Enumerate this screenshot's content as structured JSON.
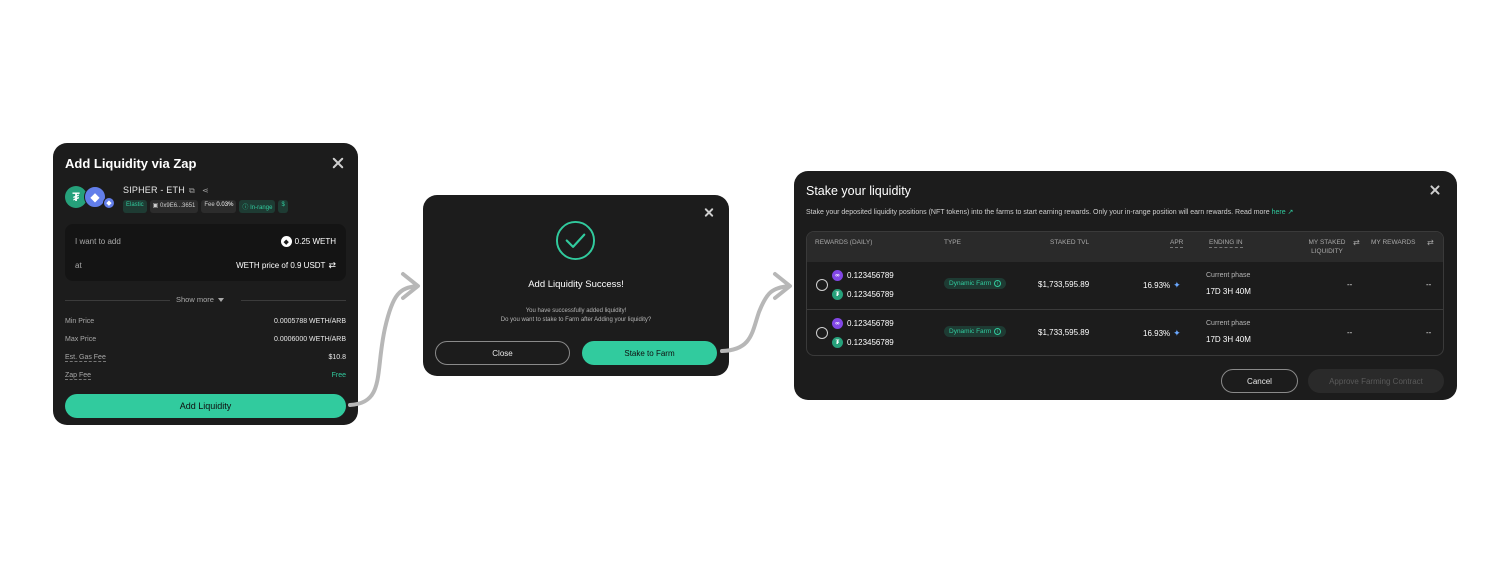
{
  "zap": {
    "title": "Add Liquidity via Zap",
    "pair": "SIPHER - ETH",
    "token_a_icon": "usdt-token-icon",
    "token_b_icon": "eth-token-icon",
    "badges": {
      "elastic": "Elastic",
      "address": "0x9E6...3651",
      "fee_label": "Fee",
      "fee_value": "0.03%",
      "range": "In-range"
    },
    "add_label": "I want to add",
    "add_value": "0.25 WETH",
    "at_label": "at",
    "at_value": "WETH price of 0.9 USDT",
    "show_more": "Show more",
    "rows": [
      {
        "label": "Min Price",
        "value": "0.0005788 WETH/ARB"
      },
      {
        "label": "Max Price",
        "value": "0.0006000 WETH/ARB"
      },
      {
        "label": "Est. Gas Fee",
        "value": "$10.8"
      },
      {
        "label": "Zap Fee",
        "value": "Free"
      }
    ],
    "button": "Add Liquidity"
  },
  "success": {
    "title": "Add Liquidity Success!",
    "message_1": "You have successfully added liquidity!",
    "message_2": "Do you want to stake to Farm after Adding your liquidity?",
    "close_button": "Close",
    "stake_button": "Stake to Farm"
  },
  "stake": {
    "title": "Stake your liquidity",
    "description": "Stake your deposited liquidity positions (NFT tokens) into the farms to start earning rewards. Only your in-range position will earn rewards. Read more",
    "here_link": "here ↗",
    "headers": {
      "rewards": "REWARDS (DAILY)",
      "type": "TYPE",
      "staked_tvl": "STAKED TVL",
      "apr": "APR",
      "ending_in": "ENDING IN",
      "my_staked_1": "MY STAKED",
      "my_staked_2": "LIQUIDITY",
      "my_rewards": "MY REWARDS"
    },
    "rows": [
      {
        "reward_1": "0.123456789",
        "reward_2": "0.123456789",
        "type": "Dynamic Farm",
        "tvl": "$1,733,595.89",
        "apr": "16.93%",
        "phase": "Current phase",
        "ending": "17D 3H 40M",
        "my_liquidity": "--",
        "my_rewards": "--"
      },
      {
        "reward_1": "0.123456789",
        "reward_2": "0.123456789",
        "type": "Dynamic Farm",
        "tvl": "$1,733,595.89",
        "apr": "16.93%",
        "phase": "Current phase",
        "ending": "17D 3H 40M",
        "my_liquidity": "--",
        "my_rewards": "--"
      }
    ],
    "cancel_button": "Cancel",
    "approve_button": "Approve Farming Contract"
  },
  "colors": {
    "accent": "#31cb9e",
    "panel": "#1c1c1c",
    "disabled": "#5a5a5a"
  }
}
